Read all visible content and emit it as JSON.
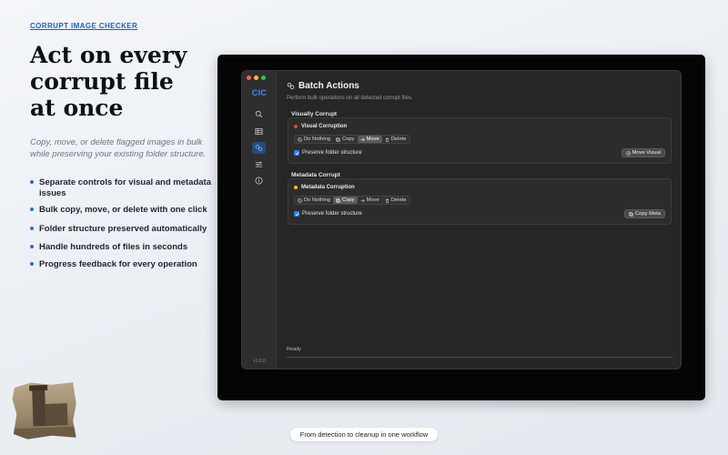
{
  "marketing": {
    "eyebrow": "CORRUPT IMAGE CHECKER",
    "headline": [
      "Act on every",
      "corrupt file",
      "at once"
    ],
    "subtitle": "Copy, move, or delete flagged images in bulk while preserving your existing folder structure.",
    "features": [
      "Separate controls for visual and metadata issues",
      "Bulk copy, move, or delete with one click",
      "Folder structure preserved automatically",
      "Handle hundreds of files in seconds",
      "Progress feedback for every operation"
    ],
    "accent_color": "#2a6fd6",
    "tagline": "From detection to cleanup in one workflow"
  },
  "app": {
    "logo": "CIC",
    "version": "v1.0.0",
    "nav": [
      "magnifier-icon",
      "table-icon",
      "links-icon",
      "sliders-icon",
      "info-icon"
    ],
    "active_nav": 2,
    "title": "Batch Actions",
    "subtitle": "Perform bulk operations on all detected corrupt files.",
    "options_labels": [
      "Do Nothing",
      "Copy",
      "Move",
      "Delete"
    ],
    "visual": {
      "section_label": "Visually Corrupt",
      "heading": "Visual Corruption",
      "dot_color": "#e0443a",
      "selected": "Move",
      "preserve_label": "Preserve folder structure",
      "preserve_checked": true,
      "action_label": "Move Visual"
    },
    "metadata": {
      "section_label": "Metadata Corrupt",
      "heading": "Metadata Corruption",
      "dot_color": "#f0c419",
      "selected": "Copy",
      "preserve_label": "Preserve folder structure",
      "preserve_checked": true,
      "action_label": "Copy Meta"
    },
    "status": "Ready",
    "progress": 0.0
  }
}
